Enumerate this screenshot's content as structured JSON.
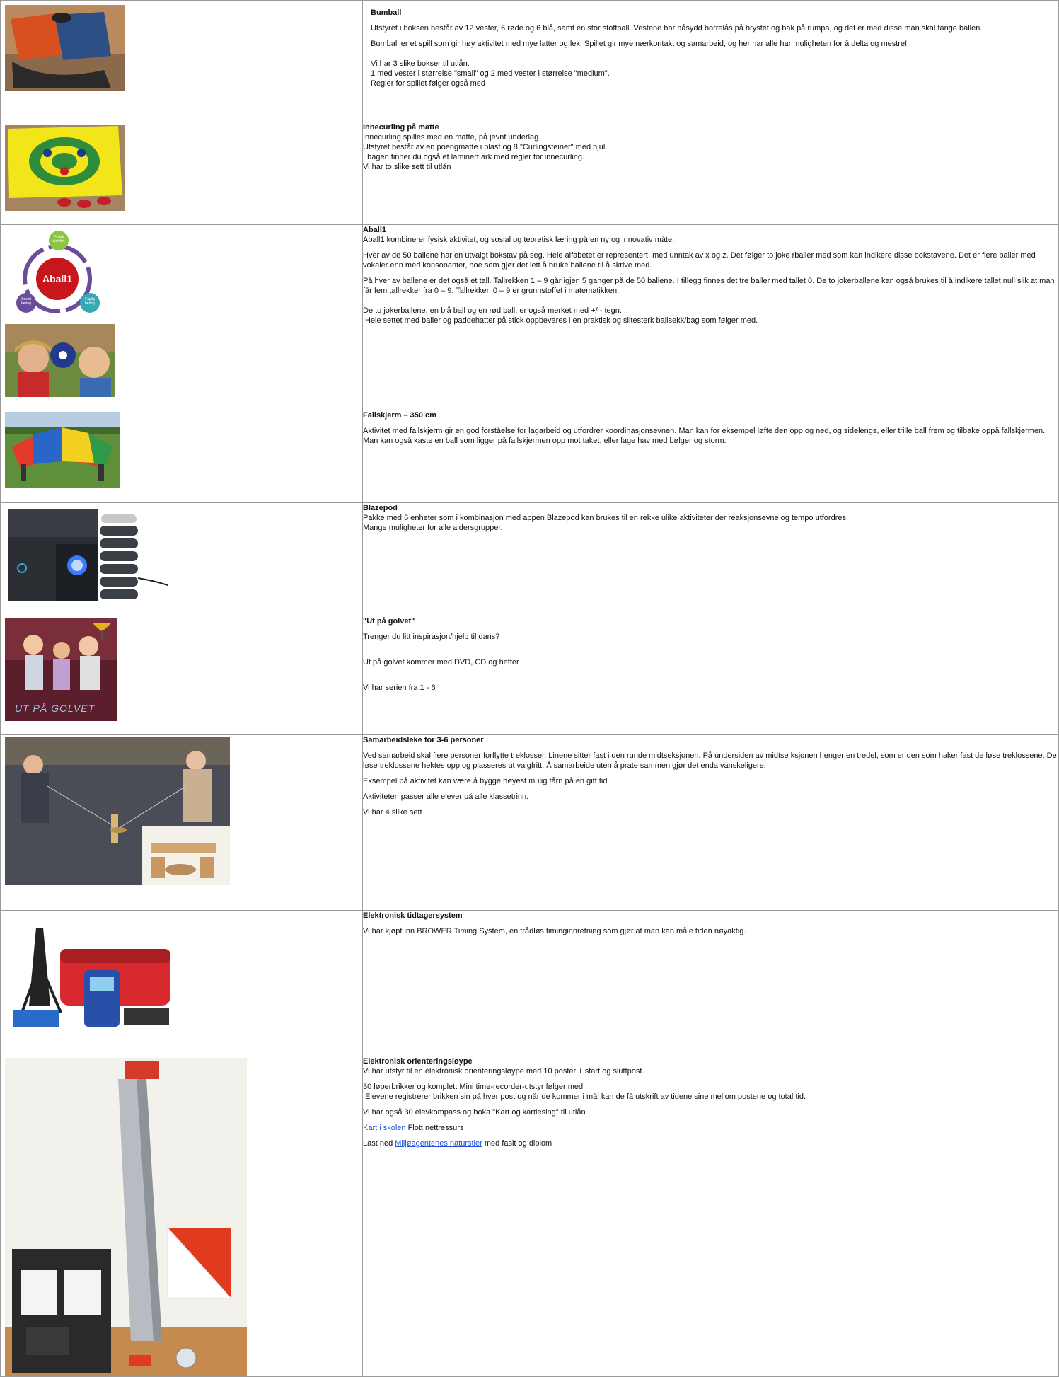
{
  "rows": [
    {
      "title": "Bumball",
      "paras": [
        "Utstyret i boksen består av 12 vester, 6 røde og 6 blå, samt en stor stoffball. Vestene har påsydd borrelås på brystet og bak på rumpa, og det er med disse man skal fange ballen.",
        "Bumball er et spill som gir høy aktivitet med mye latter og lek. Spillet gir mye nærkontakt og samarbeid, og her har alle har muligheten for å delta og mestre!",
        "Vi har 3 slike bokser til utlån.",
        "1 med vester i størrelse \"small\" og 2 med vester i størrelse \"medium\".",
        "Regler for spillet følger også med"
      ]
    },
    {
      "title": "Innecurling på matte",
      "paras": [
        "Innecurling spilles med en matte, på jevnt underlag.",
        "Utstyret består av en poengmatte i plast og 8 \"Curlingsteiner\" med hjul.",
        "I bagen finner du også et laminert ark med regler for innecurling.",
        "Vi har to slike sett til utlån"
      ]
    },
    {
      "title": "Aball1",
      "logo": {
        "center": "Aball1",
        "top": "Fysisk aktivitet",
        "left": "Sosial læring",
        "right": "Faglig læring"
      },
      "paras": [
        "Aball1 kombinerer fysisk aktivitet, og sosial og teoretisk læring på en ny og innovativ måte.",
        "Hver av de 50 ballene har en utvalgt bokstav på seg. Hele alfabetet er representert, med unntak av x og z. Det følger to joke rballer med som kan indikere disse bokstavene. Det er flere baller med vokaler enn med konsonanter, noe som gjør det lett å bruke ballene til å skrive med.",
        "På hver av ballene er det også et tall. Tallrekken 1 – 9 går igjen 5 ganger på de 50 ballene. I tillegg finnes det tre baller med tallet 0. De to jokerballene kan også brukes til å indikere tallet null slik at man får fem tallrekker fra 0 – 9. Tallrekken 0 – 9 er grunnstoffet i matematikken.",
        "De to jokerballene, en blå ball og en rød ball, er også merket med +/ - tegn.",
        "Hele settet med baller og paddehatter på stick oppbevares i en praktisk og slitesterk ballsekk/bag som følger med."
      ]
    },
    {
      "title": "Fallskjerm – 350 cm",
      "paras": [
        "Aktivitet med fallskjerm gir en god forståelse for lagarbeid og utfordrer koordinasjonsevnen. Man kan for eksempel løfte den  opp og ned, og sidelengs, eller trille ball frem og tilbake oppå fallskjermen. Man kan også kaste en ball som ligger på fallskjermen opp mot taket, eller lage hav med bølger og  storm."
      ]
    },
    {
      "title": "Blazepod",
      "paras": [
        "Pakke med 6 enheter som i kombinasjon med appen Blazepod kan brukes til en rekke ulike aktiviteter der reaksjonsevne og tempo  utfordres.",
        "Mange muligheter for alle aldersgrupper."
      ]
    },
    {
      "title": "\"Ut på golvet\"",
      "cover_text": "UT PÅ GOLVET",
      "paras": [
        "Trenger du litt inspirasjon/hjelp til dans?",
        "Ut på golvet kommer med DVD, CD og hefter",
        "Vi har serien fra 1 - 6"
      ]
    },
    {
      "title": "Samarbeidsleke for 3-6 personer",
      "paras": [
        "Ved samarbeid skal flere personer forflytte treklosser. Linene sitter fast i den runde midtseksjonen. På undersiden av midtse ksjonen henger en tredel, som er den som haker fast de løse treklossene. De løse treklossene hektes opp og plasseres ut valgfritt. Å samarbeide uten å prate sammen gjør det  enda vanskeligere.",
        "Eksempel på aktivitet kan være å bygge høyest mulig tårn på en gitt tid.",
        "Aktiviteten passer alle elever på alle klassetrinn.",
        "Vi har 4 slike sett"
      ]
    },
    {
      "title": "Elektronisk tidtagersystem",
      "paras": [
        "Vi har kjøpt inn BROWER Timing System, en trådløs timinginnretning som gjør at man kan måle tiden nøyaktig."
      ]
    },
    {
      "title": "Elektronisk orienteringsløype",
      "paras": [
        "Vi har utstyr til en elektronisk orienteringsløype med 10 poster + start og sluttpost.",
        "30 løperbrikker og komplett Mini time-recorder-utstyr følger med",
        "Elevene registrerer brikken sin på hver post og når de kommer i mål kan de få utskrift av tidene sine mellom postene og total tid.",
        "Vi har også 30 elevkompass og boka \"Kart og kartlesing\" til utlån"
      ],
      "link1": {
        "text": "Kart i skolen",
        "after": " Flott nettressurs"
      },
      "link2": {
        "before": "Last ned ",
        "text": "Miljøagentenes naturstier",
        "after": " med fasit og diplom"
      }
    }
  ]
}
